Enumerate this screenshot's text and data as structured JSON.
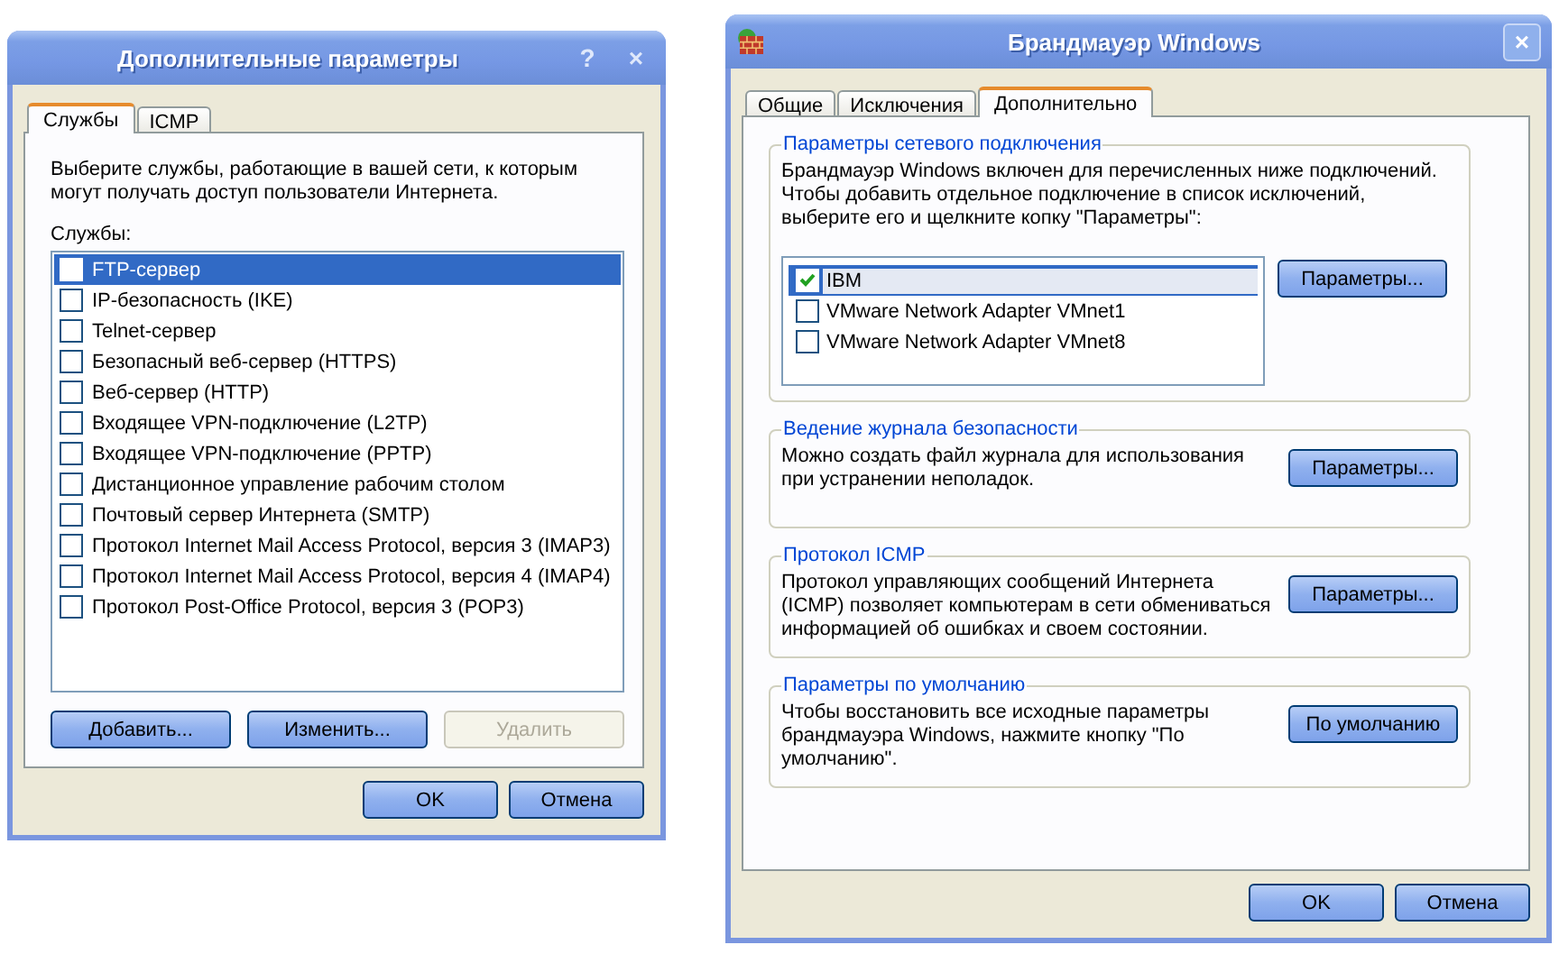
{
  "left_dialog": {
    "title": "Дополнительные параметры",
    "title_buttons": [
      "?",
      "×"
    ],
    "tabs": [
      {
        "label": "Службы",
        "selected": true
      },
      {
        "label": "ICMP",
        "selected": false
      }
    ],
    "intro": "Выберите службы, работающие в вашей сети, к которым могут получать доступ пользователи Интернета.",
    "list_label": "Службы:",
    "services": [
      {
        "label": "FTP-сервер",
        "checked": false,
        "selected": true
      },
      {
        "label": "IP-безопасность (IKE)",
        "checked": false,
        "selected": false
      },
      {
        "label": "Telnet-сервер",
        "checked": false,
        "selected": false
      },
      {
        "label": "Безопасный веб-сервер (HTTPS)",
        "checked": false,
        "selected": false
      },
      {
        "label": "Веб-сервер (HTTP)",
        "checked": false,
        "selected": false
      },
      {
        "label": "Входящее VPN-подключение (L2TP)",
        "checked": false,
        "selected": false
      },
      {
        "label": "Входящее VPN-подключение (PPTP)",
        "checked": false,
        "selected": false
      },
      {
        "label": "Дистанционное управление рабочим столом",
        "checked": false,
        "selected": false
      },
      {
        "label": "Почтовый сервер Интернета (SMTP)",
        "checked": false,
        "selected": false
      },
      {
        "label": "Протокол Internet Mail Access Protocol, версия 3 (IMAP3)",
        "checked": false,
        "selected": false
      },
      {
        "label": "Протокол Internet Mail Access Protocol, версия 4 (IMAP4)",
        "checked": false,
        "selected": false
      },
      {
        "label": "Протокол Post-Office Protocol, версия 3 (POP3)",
        "checked": false,
        "selected": false
      }
    ],
    "list_buttons": [
      {
        "label": "Добавить...",
        "disabled": false
      },
      {
        "label": "Изменить...",
        "disabled": false
      },
      {
        "label": "Удалить",
        "disabled": true
      }
    ],
    "footer_buttons": [
      "OK",
      "Отмена"
    ]
  },
  "right_dialog": {
    "title": "Брандмауэр Windows",
    "close": "×",
    "tabs": [
      {
        "label": "Общие",
        "selected": false
      },
      {
        "label": "Исключения",
        "selected": false
      },
      {
        "label": "Дополнительно",
        "selected": true
      }
    ],
    "groups": [
      {
        "title": "Параметры сетевого подключения",
        "text": "Брандмауэр Windows включен для перечисленных ниже подключений. Чтобы добавить отдельное подключение в список исключений, выберите его и щелкните копку \"Параметры\":",
        "button": "Параметры...",
        "connections": [
          {
            "label": "IBM",
            "checked": true,
            "selected": true
          },
          {
            "label": "VMware Network Adapter VMnet1",
            "checked": false,
            "selected": false
          },
          {
            "label": "VMware Network Adapter VMnet8",
            "checked": false,
            "selected": false
          }
        ]
      },
      {
        "title": "Ведение журнала безопасности",
        "text": "Можно создать файл журнала для использования при устранении неполадок.",
        "button": "Параметры..."
      },
      {
        "title": "Протокол ICMP",
        "text": "Протокол управляющих сообщений Интернета (ICMP) позволяет компьютерам в сети обмениваться информацией об ошибках и своем состоянии.",
        "button": "Параметры..."
      },
      {
        "title": "Параметры по умолчанию",
        "text": "Чтобы восстановить все исходные параметры брандмауэра Windows, нажмите кнопку \"По умолчанию\".",
        "button": "По умолчанию"
      }
    ],
    "footer_buttons": [
      "OK",
      "Отмена"
    ]
  }
}
